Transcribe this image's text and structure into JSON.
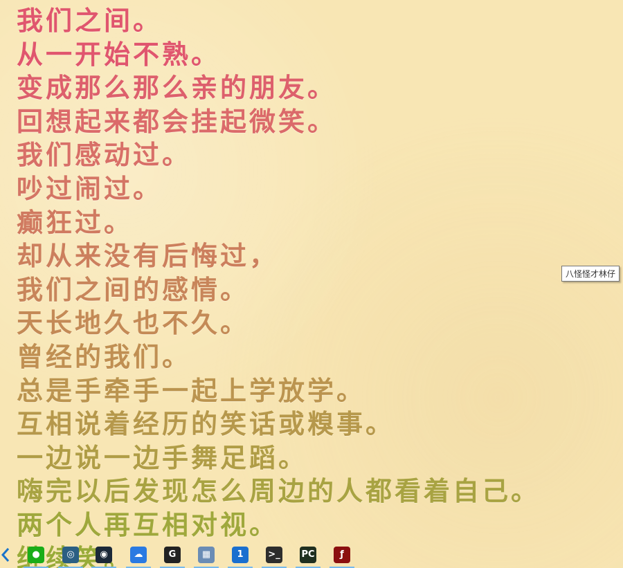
{
  "poem": {
    "lines": [
      "我们之间。",
      "从一开始不熟。",
      "变成那么那么亲的朋友。",
      "回想起来都会挂起微笑。",
      "我们感动过。",
      "吵过闹过。",
      "癫狂过。",
      "却从来没有后悔过，",
      "我们之间的感情。",
      "天长地久也不久。",
      "曾经的我们。",
      "总是手牵手一起上学放学。",
      "互相说着经历的笑话或糗事。",
      "一边说一边手舞足蹈。",
      "嗨完以后发现怎么周边的人都看着自己。",
      "两个人再互相对视。",
      "继续笑。"
    ],
    "colors": [
      "#e0566e",
      "#e0566e",
      "#dd5f6c",
      "#db6a6a",
      "#d86f67",
      "#d47564",
      "#d07a60",
      "#cc7f5d",
      "#c8855a",
      "#c48a56",
      "#c08f52",
      "#bb944f",
      "#b6984b",
      "#b09d46",
      "#a8a342",
      "#9fa83c",
      "#98ab38"
    ]
  },
  "tooltip": {
    "text": "八怪怪才林仔"
  },
  "taskbar": {
    "items": [
      {
        "icon": "wechat-icon",
        "color": "#1aad19",
        "glyph": "●"
      },
      {
        "icon": "app-circle-icon",
        "color": "#2b5f83",
        "glyph": "◎"
      },
      {
        "icon": "steam-icon",
        "color": "#1b2838",
        "glyph": "◉"
      },
      {
        "icon": "cloud-icon",
        "color": "#2a7ae2",
        "glyph": "☁"
      },
      {
        "icon": "g-icon",
        "color": "#222222",
        "glyph": "G"
      },
      {
        "icon": "photo-viewer-icon",
        "color": "#6a8cb5",
        "glyph": "▦"
      },
      {
        "icon": "password-manager-icon",
        "color": "#1a6fcf",
        "glyph": "1"
      },
      {
        "icon": "terminal-icon",
        "color": "#2d2d2d",
        "glyph": ">_"
      },
      {
        "icon": "pycharm-icon",
        "color": "#1f2f1f",
        "glyph": "PC"
      },
      {
        "icon": "flash-icon",
        "color": "#8b0f0f",
        "glyph": "ƒ"
      }
    ]
  }
}
